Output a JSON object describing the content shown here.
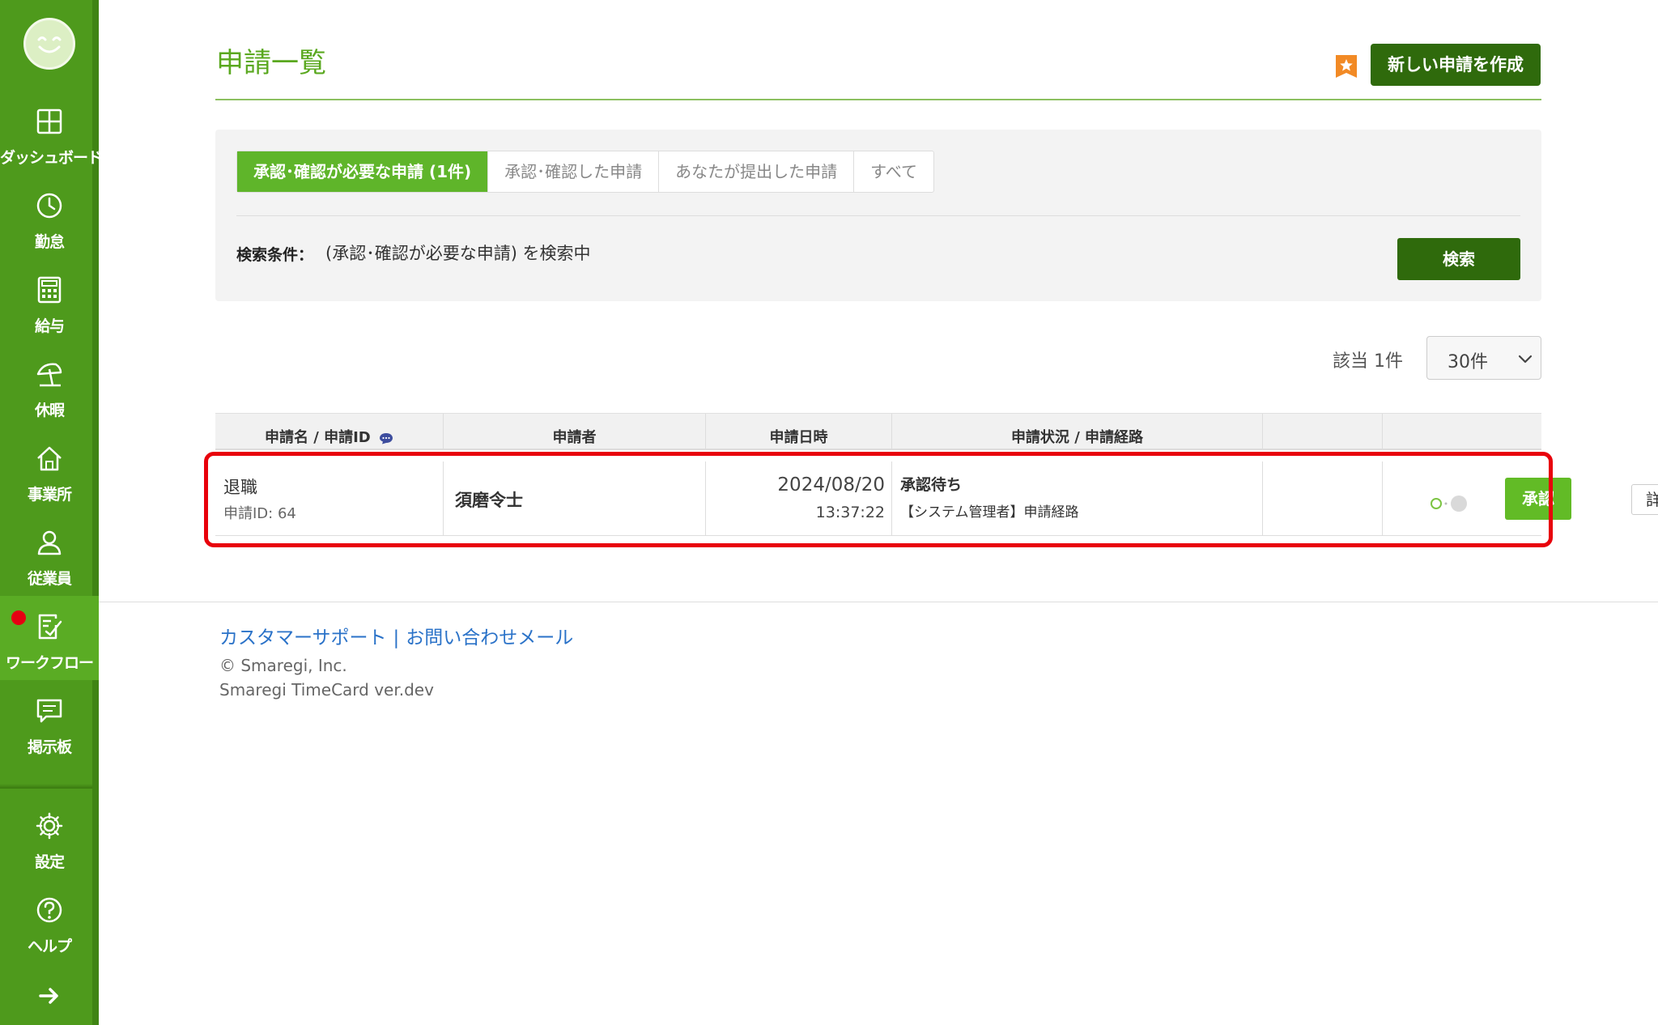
{
  "sidebar": {
    "items": [
      {
        "label": "ダッシュボード",
        "icon": "dashboard-icon"
      },
      {
        "label": "勤怠",
        "icon": "clock-icon"
      },
      {
        "label": "給与",
        "icon": "calculator-icon"
      },
      {
        "label": "休暇",
        "icon": "beach-umbrella-icon"
      },
      {
        "label": "事業所",
        "icon": "home-icon"
      },
      {
        "label": "従業員",
        "icon": "person-icon"
      },
      {
        "label": "ワークフロー",
        "icon": "workflow-icon",
        "active": true,
        "badge": "red-dot"
      },
      {
        "label": "掲示板",
        "icon": "message-board-icon"
      }
    ],
    "bottom_items": [
      {
        "label": "設定",
        "icon": "gear-icon"
      },
      {
        "label": "ヘルプ",
        "icon": "help-icon"
      }
    ],
    "collapse_icon": "arrow-right-icon",
    "colors": {
      "background": "#4e9a1c",
      "active": "#5aac24",
      "badge": "#e60012"
    }
  },
  "header": {
    "title": "申請一覧",
    "create_button": "新しい申請を作成",
    "favorite_icon": "star-icon"
  },
  "filter": {
    "tabs": [
      {
        "label": "承認･確認が必要な申請 (1件)",
        "active": true
      },
      {
        "label": "承認･確認した申請"
      },
      {
        "label": "あなたが提出した申請"
      },
      {
        "label": "すべて"
      }
    ],
    "condition_label": "検索条件：",
    "condition_text": "(承認･確認が必要な申請) を検索中",
    "search_button": "検索"
  },
  "results": {
    "count_text": "該当 1件",
    "per_page": "30件"
  },
  "table": {
    "headers": [
      "申請名 / 申請ID",
      "申請者",
      "申請日時",
      "申請状況 / 申請経路",
      "",
      ""
    ],
    "rows": [
      {
        "name": "退職",
        "id": "申請ID: 64",
        "applicant": "須磨令士",
        "date": "2024/08/20",
        "time": "13:37:22",
        "status": "承認待ち",
        "route": "【システム管理者】申請経路",
        "approve_button": "承認",
        "detail_button": "詳細"
      }
    ]
  },
  "footer": {
    "link_support": "カスタマーサポート",
    "separator": "|",
    "link_contact": "お問い合わせメール",
    "copyright": "© Smaregi, Inc.",
    "version": "Smaregi TimeCard ver.dev"
  },
  "colors": {
    "accent": "#5aa81f",
    "primary_button": "#2f6a0c",
    "approve_button": "#62bb26",
    "highlight": "#e8000b",
    "link": "#2a72c8"
  }
}
